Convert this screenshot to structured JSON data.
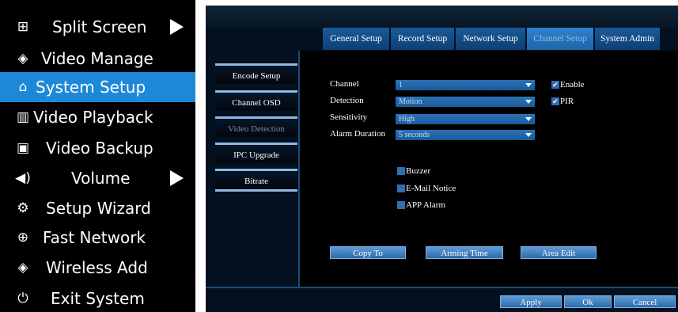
{
  "menu": {
    "items": [
      {
        "label": "Split Screen",
        "icon": "⊞",
        "has_submenu": true
      },
      {
        "label": "Video Manage",
        "icon": "◈",
        "has_submenu": false
      },
      {
        "label": "System Setup",
        "icon": "⌂",
        "has_submenu": false
      },
      {
        "label": "Video Playback",
        "icon": "▥",
        "has_submenu": false
      },
      {
        "label": "Video Backup",
        "icon": "▣",
        "has_submenu": false
      },
      {
        "label": "Volume",
        "icon": "◀)",
        "has_submenu": true
      },
      {
        "label": "Setup Wizard",
        "icon": "⚙",
        "has_submenu": false
      },
      {
        "label": "Fast Network",
        "icon": "⊕",
        "has_submenu": false
      },
      {
        "label": "Wireless Add",
        "icon": "◈",
        "has_submenu": false
      },
      {
        "label": "Exit System",
        "icon": "⏻",
        "has_submenu": false
      }
    ],
    "selected": "System Setup",
    "highlight_color": "#1e88d8"
  },
  "setup": {
    "tabs": [
      "General Setup",
      "Record Setup",
      "Network Setup",
      "Channel Setup",
      "System Admin"
    ],
    "active_tab": "Channel Setup",
    "side_menu": [
      "Encode Setup",
      "Channel OSD",
      "Video Detection",
      "IPC Upgrade",
      "Bitrate"
    ],
    "active_side": "Video Detection",
    "fields": [
      {
        "label": "Channel",
        "value": "1"
      },
      {
        "label": "Detection",
        "value": "Motion"
      },
      {
        "label": "Sensitivity",
        "value": "High"
      },
      {
        "label": "Alarm Duration",
        "value": "5 seconds"
      }
    ],
    "toggles": [
      {
        "label": "Enable",
        "checked": true
      },
      {
        "label": "PIR",
        "checked": true
      }
    ],
    "alarm_options": [
      {
        "label": "Buzzer",
        "checked": false
      },
      {
        "label": "E-Mail Notice",
        "checked": false
      },
      {
        "label": "APP Alarm",
        "checked": false
      }
    ],
    "action_buttons": [
      "Copy To",
      "Arming Time",
      "Area Edit"
    ],
    "footer_buttons": [
      "Apply",
      "Ok",
      "Cancel"
    ]
  }
}
